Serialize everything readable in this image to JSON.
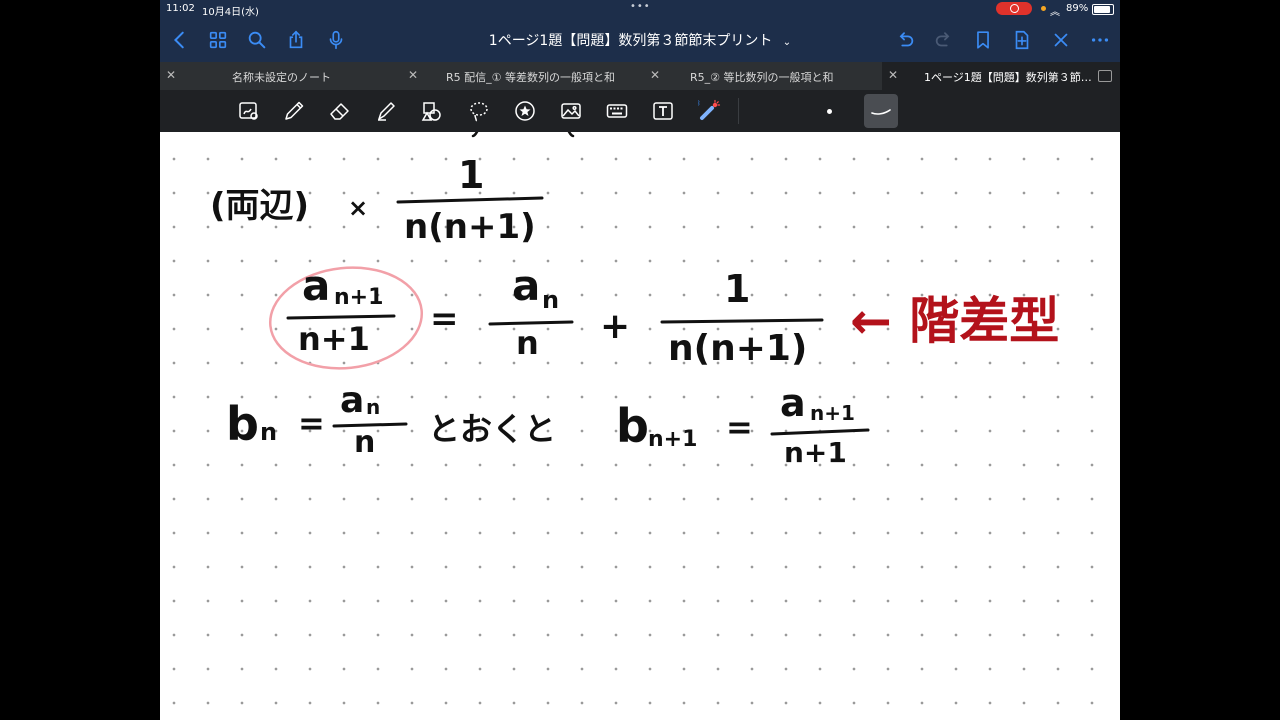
{
  "status_bar": {
    "time": "11:02",
    "date": "10月4日(水)",
    "battery": "89%"
  },
  "nav": {
    "document_title": "1ページ1題【問題】数列第３節節末プリント",
    "icons": [
      "chevron-left-icon",
      "grid-icon",
      "search-icon",
      "share-icon",
      "microphone-icon",
      "undo-icon",
      "redo-icon",
      "bookmark-icon",
      "add-page-icon",
      "close-icon",
      "more-icon"
    ]
  },
  "tabs": [
    {
      "label": "名称未設定のノート",
      "active": false
    },
    {
      "label": "R5 配信_① 等差数列の一般項と和",
      "active": false
    },
    {
      "label": "R5_② 等比数列の一般項と和",
      "active": false
    },
    {
      "label": "1ページ1題【問題】数列第３節…",
      "active": true
    }
  ],
  "toolbar": {
    "tools": [
      "zoom-icon",
      "pen-icon",
      "eraser-icon",
      "highlighter-icon",
      "shapes-icon",
      "lasso-icon",
      "sticker-icon",
      "image-icon",
      "keyboard-icon",
      "text-box-icon",
      "laser-pointer-icon",
      "pen-size-dot-icon",
      "pen-stroke-icon"
    ]
  },
  "handwriting": {
    "line1_label": "(両辺)",
    "line1_times": "×",
    "line1_frac_num": "1",
    "line1_frac_den": "n(n+1)",
    "eq_lhs_num": "a",
    "eq_lhs_num_sub": "n+1",
    "eq_lhs_den": "n+1",
    "eq_equals": "=",
    "eq_r1_num": "a",
    "eq_r1_num_sub": "n",
    "eq_r1_den": "n",
    "eq_plus": "+",
    "eq_r2_num": "1",
    "eq_r2_den": "n(n+1)",
    "annotation": "← 階差型",
    "line3_b": "b",
    "line3_b_sub": "n",
    "line3_eq": "=",
    "line3_frac_num": "a",
    "line3_frac_num_sub": "n",
    "line3_frac_den": "n",
    "line3_text": "とおくと",
    "line3_b2": "b",
    "line3_b2_sub": "n+1",
    "line3_eq2": "=",
    "line3_frac2_num": "a",
    "line3_frac2_num_sub": "n+1",
    "line3_frac2_den": "n+1"
  },
  "colors": {
    "nav_bg": "#1d2e4a",
    "accent": "#3b8cf5",
    "ink": "#111111",
    "annotation_ink": "#b3121b",
    "highlight_circle": "#f2a0a8"
  }
}
